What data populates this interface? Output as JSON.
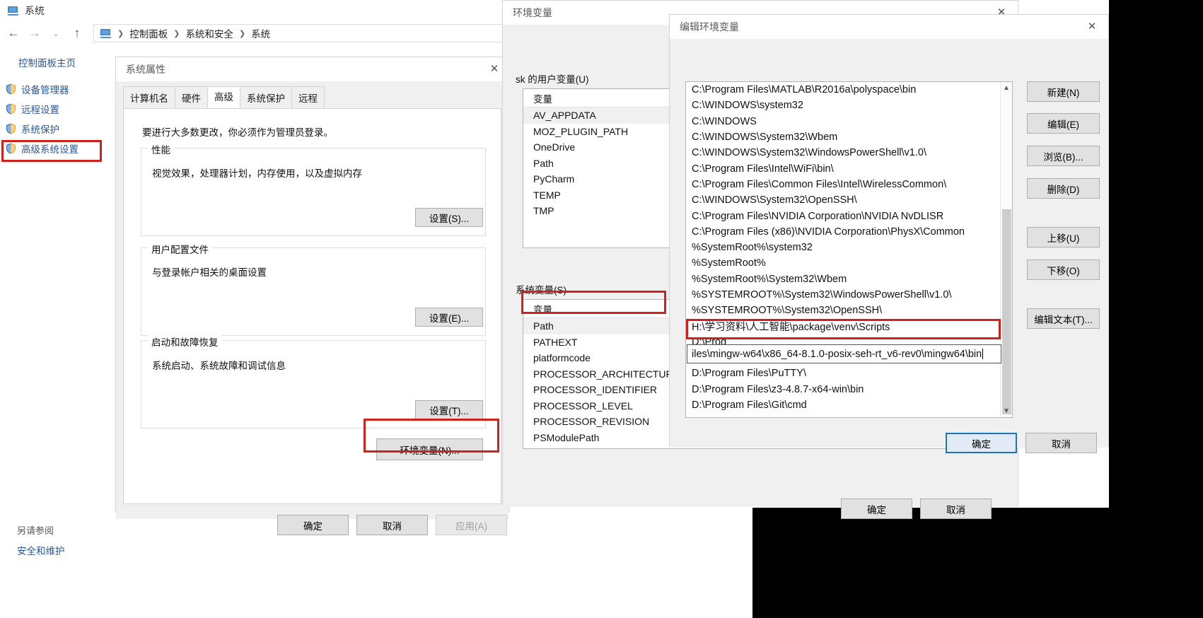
{
  "control_panel": {
    "window_title": "系统",
    "breadcrumb": [
      "控制面板",
      "系统和安全",
      "系统"
    ],
    "sidebar": {
      "home_label": "控制面板主页",
      "items": [
        {
          "label": "设备管理器",
          "icon": "shield-icon",
          "highlighted": false
        },
        {
          "label": "远程设置",
          "icon": "shield-icon",
          "highlighted": false
        },
        {
          "label": "系统保护",
          "icon": "shield-icon",
          "highlighted": false
        },
        {
          "label": "高级系统设置",
          "icon": "shield-icon",
          "highlighted": true
        }
      ]
    },
    "see_also_label": "另请参阅",
    "see_also_link": "安全和维护",
    "nav": {
      "back": "◀",
      "forward": "▶",
      "recent": "⌄",
      "up": "↑"
    }
  },
  "system_properties": {
    "title": "系统属性",
    "tabs": [
      {
        "label": "计算机名",
        "selected": false
      },
      {
        "label": "硬件",
        "selected": false
      },
      {
        "label": "高级",
        "selected": true
      },
      {
        "label": "系统保护",
        "selected": false
      },
      {
        "label": "远程",
        "selected": false
      }
    ],
    "admin_note": "要进行大多数更改，你必须作为管理员登录。",
    "groups": [
      {
        "title": "性能",
        "desc": "视觉效果，处理器计划，内存使用，以及虚拟内存",
        "button": "设置(S)..."
      },
      {
        "title": "用户配置文件",
        "desc": "与登录帐户相关的桌面设置",
        "button": "设置(E)..."
      },
      {
        "title": "启动和故障恢复",
        "desc": "系统启动、系统故障和调试信息",
        "button": "设置(T)..."
      }
    ],
    "env_button": "环境变量(N)...",
    "footer": {
      "ok": "确定",
      "cancel": "取消",
      "apply": "应用(A)"
    }
  },
  "environment_variables": {
    "title": "环境变量",
    "user_section_label": "sk 的用户变量(U)",
    "user_column_header": "变量",
    "user_variables": [
      {
        "name": "AV_APPDATA",
        "selected": true
      },
      {
        "name": "MOZ_PLUGIN_PATH",
        "selected": false
      },
      {
        "name": "OneDrive",
        "selected": false
      },
      {
        "name": "Path",
        "selected": false
      },
      {
        "name": "PyCharm",
        "selected": false
      },
      {
        "name": "TEMP",
        "selected": false
      },
      {
        "name": "TMP",
        "selected": false
      }
    ],
    "system_section_label": "系统变量(S)",
    "system_column_header": "变量",
    "system_variables": [
      {
        "name": "Path",
        "selected": true,
        "highlighted": true
      },
      {
        "name": "PATHEXT",
        "selected": false,
        "highlighted": false
      },
      {
        "name": "platformcode",
        "selected": false,
        "highlighted": false
      },
      {
        "name": "PROCESSOR_ARCHITECTURE",
        "selected": false,
        "highlighted": false
      },
      {
        "name": "PROCESSOR_IDENTIFIER",
        "selected": false,
        "highlighted": false
      },
      {
        "name": "PROCESSOR_LEVEL",
        "selected": false,
        "highlighted": false
      },
      {
        "name": "PROCESSOR_REVISION",
        "selected": false,
        "highlighted": false
      },
      {
        "name": "PSModulePath",
        "selected": false,
        "highlighted": false
      }
    ],
    "footer": {
      "ok": "确定",
      "cancel": "取消"
    }
  },
  "edit_env_var": {
    "title": "编辑环境变量",
    "close_icon": "close-icon",
    "paths": [
      "C:\\Program Files\\MATLAB\\R2016a\\polyspace\\bin",
      "C:\\WINDOWS\\system32",
      "C:\\WINDOWS",
      "C:\\WINDOWS\\System32\\Wbem",
      "C:\\WINDOWS\\System32\\WindowsPowerShell\\v1.0\\",
      "C:\\Program Files\\Intel\\WiFi\\bin\\",
      "C:\\Program Files\\Common Files\\Intel\\WirelessCommon\\",
      "C:\\WINDOWS\\System32\\OpenSSH\\",
      "C:\\Program Files\\NVIDIA Corporation\\NVIDIA NvDLISR",
      "C:\\Program Files (x86)\\NVIDIA Corporation\\PhysX\\Common",
      "%SystemRoot%\\system32",
      "%SystemRoot%",
      "%SystemRoot%\\System32\\Wbem",
      "%SYSTEMROOT%\\System32\\WindowsPowerShell\\v1.0\\",
      "%SYSTEMROOT%\\System32\\OpenSSH\\",
      "H:\\学习资料\\人工智能\\package\\venv\\Scripts",
      "D:\\Prog",
      "D:\\Program Files\\PuTTY\\",
      "D:\\Program Files\\z3-4.8.7-x64-win\\bin",
      "D:\\Program Files\\Git\\cmd"
    ],
    "editing_row_text": "iles\\mingw-w64\\x86_64-8.1.0-posix-seh-rt_v6-rev0\\mingw64\\bin",
    "side_buttons": [
      "新建(N)",
      "编辑(E)",
      "浏览(B)...",
      "删除(D)",
      "上移(U)",
      "下移(O)",
      "编辑文本(T)..."
    ],
    "footer": {
      "ok": "确定",
      "cancel": "取消"
    }
  },
  "colors": {
    "annotation_red": "#d0211c",
    "link_blue": "#2b5797",
    "default_button_border": "#1b73ba"
  }
}
